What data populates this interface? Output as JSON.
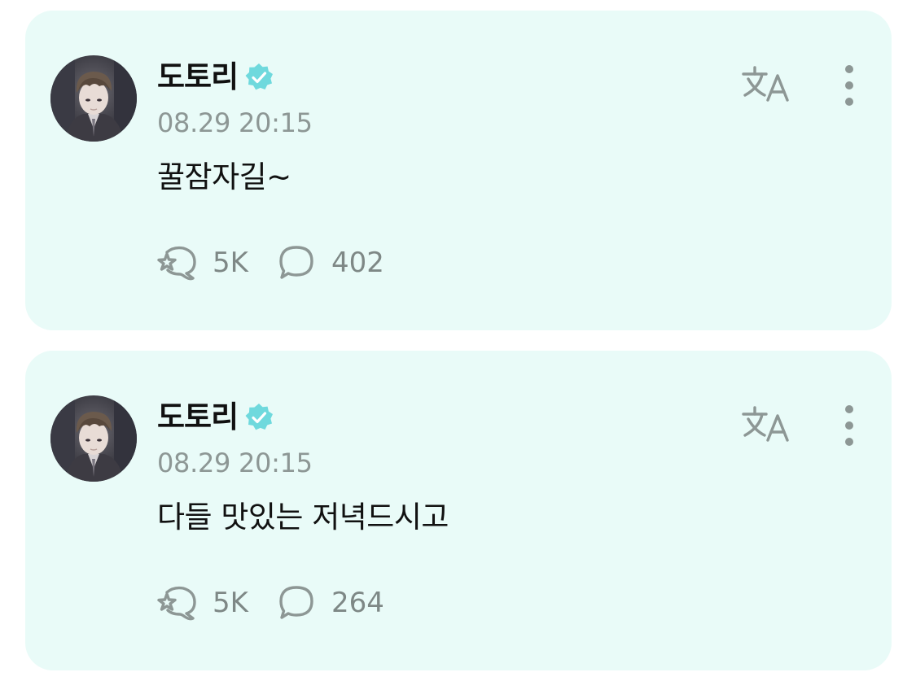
{
  "colors": {
    "card_background": "#e9fbf8",
    "verified_badge": "#6fd9dd",
    "icon_gray": "#8d9795"
  },
  "icons": {
    "verified": "verified-badge-icon",
    "translate": "translate-icon",
    "more": "more-vertical-icon",
    "reaction": "reaction-icon",
    "comment": "comment-icon"
  },
  "posts": [
    {
      "author": "도토리",
      "timestamp": "08.29 20:15",
      "content": "꿀잠자길~",
      "reactions": "5K",
      "comments": "402"
    },
    {
      "author": "도토리",
      "timestamp": "08.29 20:15",
      "content": "다들 맛있는 저녁드시고",
      "reactions": "5K",
      "comments": "264"
    }
  ]
}
